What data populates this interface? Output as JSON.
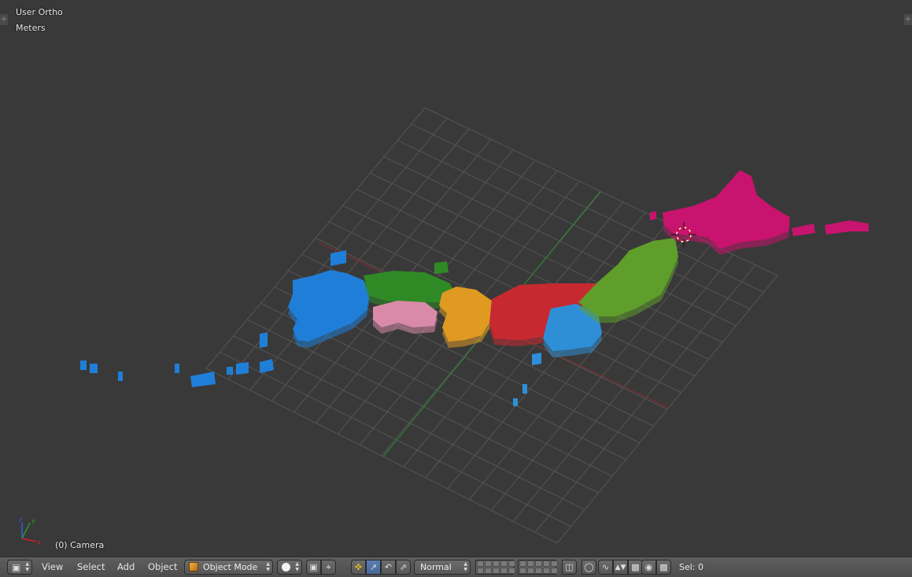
{
  "viewport": {
    "view_name": "User Ortho",
    "units": "Meters",
    "active_object": "(0) Camera",
    "axis_x": "x",
    "axis_y": "y",
    "axis_z": "z"
  },
  "header": {
    "editor_type_icon": "cube-icon",
    "menus": [
      "View",
      "Select",
      "Add",
      "Object"
    ],
    "mode": "Object Mode",
    "mode_icon": "orange-cube-icon",
    "shading_icon": "solid-sphere-icon",
    "transform_orientation": "Normal",
    "selection_status": "Sel: 0"
  },
  "colors": {
    "background": "#393939",
    "grid": "#555555",
    "x_axis": "#8a2b2b",
    "y_axis": "#2e8a2e",
    "hokkaido": "#c8146e",
    "tohoku": "#5f9e2a",
    "kanto": "#2f8fd6",
    "chubu": "#c62a30",
    "kinki": "#e09a22",
    "chugoku": "#2f8a26",
    "shikoku": "#d98aa8",
    "kyushu": "#1f7fd8"
  }
}
